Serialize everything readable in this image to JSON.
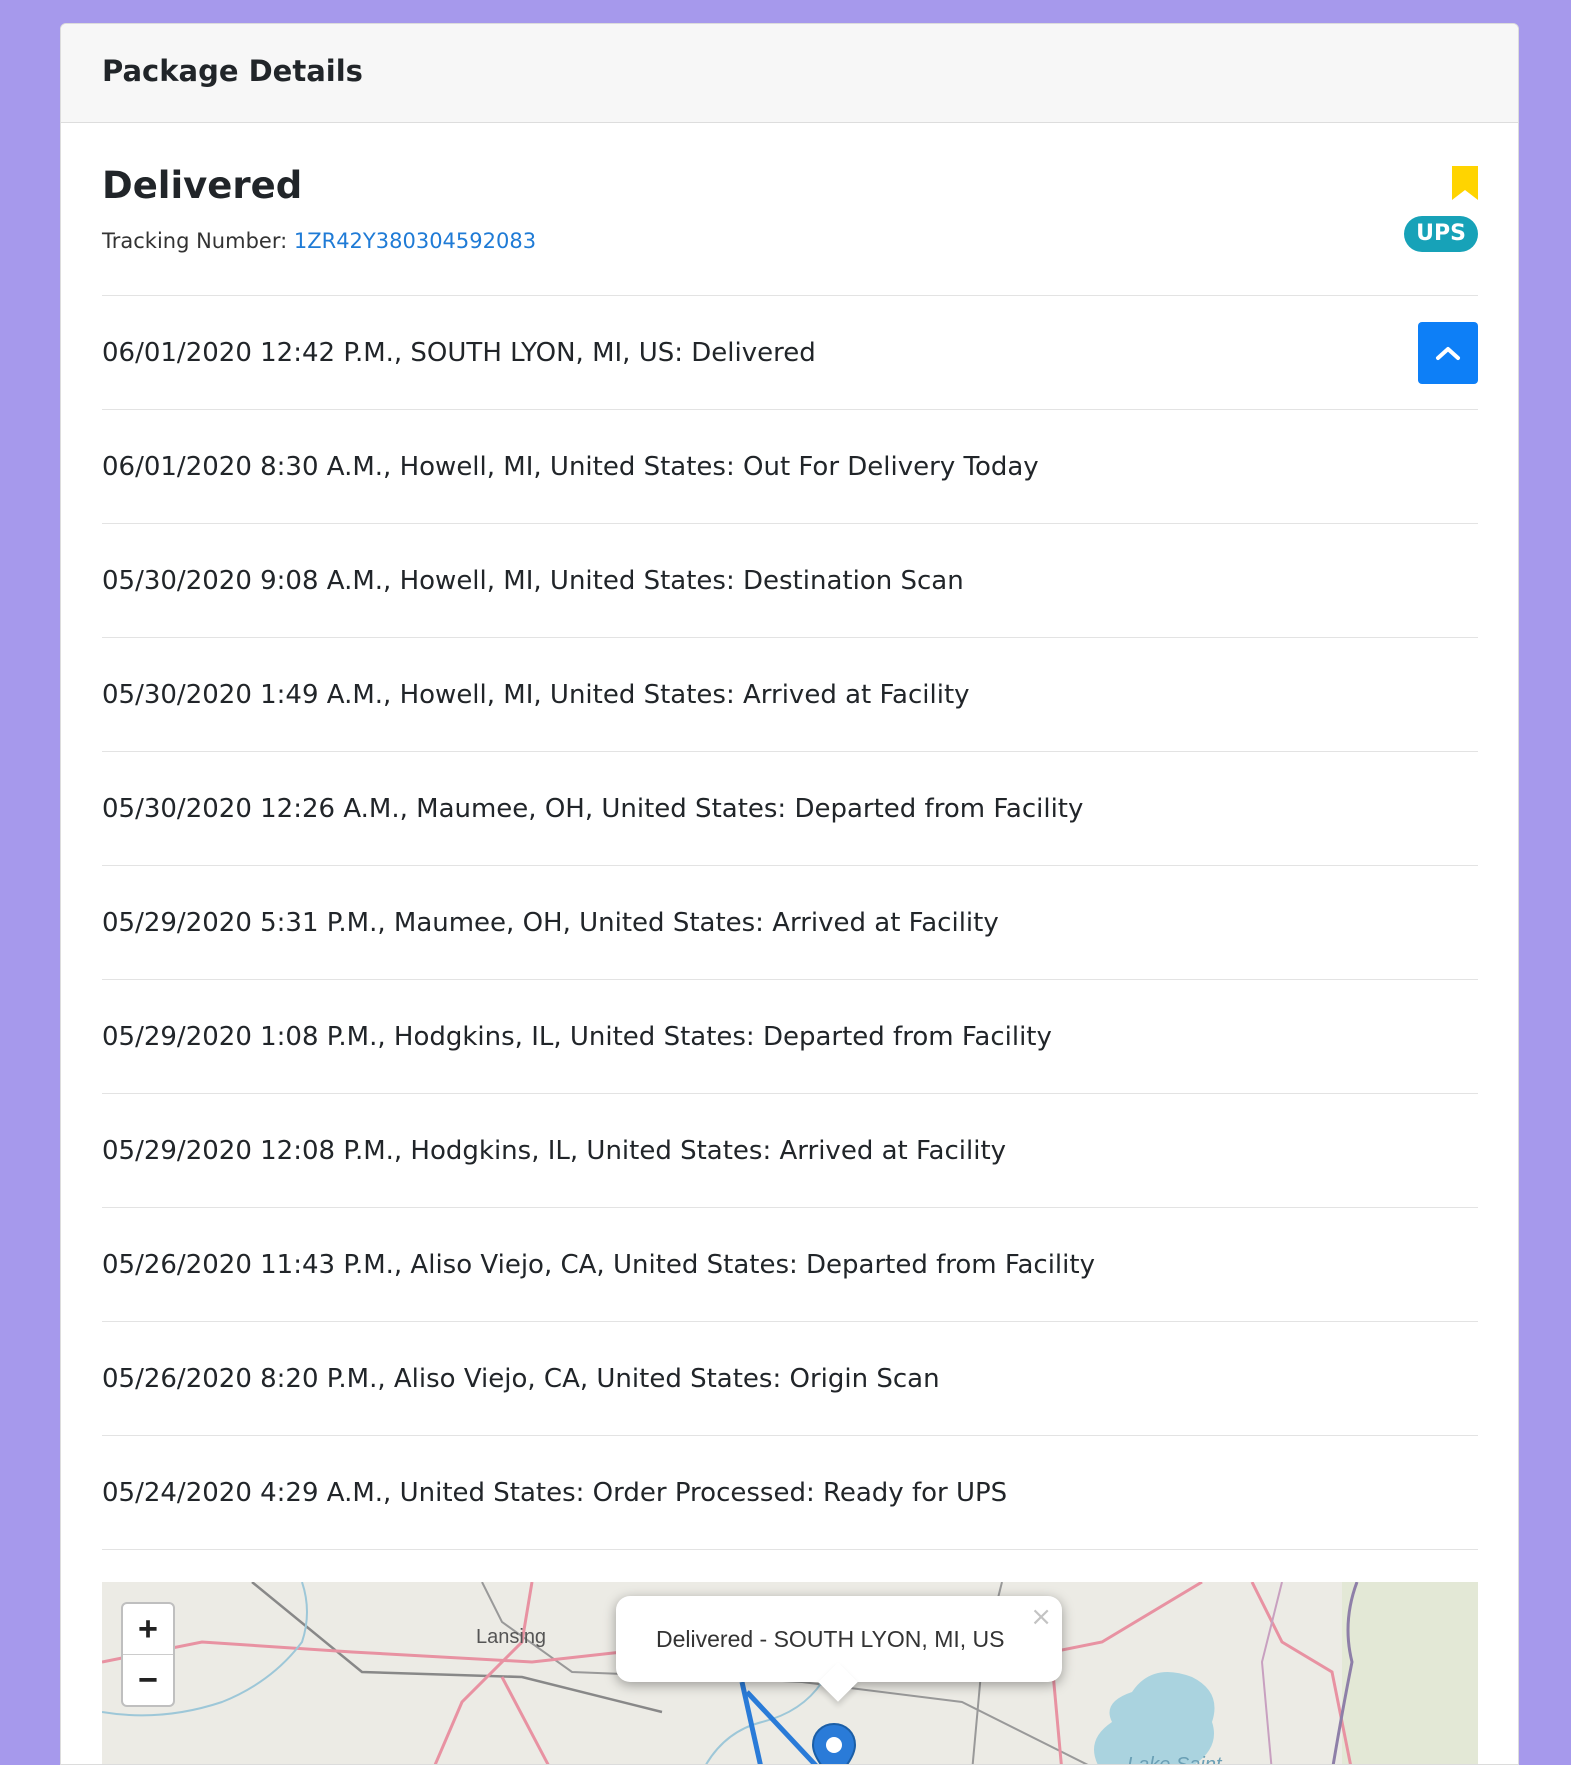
{
  "header": {
    "title": "Package Details"
  },
  "package": {
    "status": "Delivered",
    "tracking_label": "Tracking Number:",
    "tracking_number": "1ZR42Y380304592083",
    "carrier": "UPS"
  },
  "events": [
    "06/01/2020 12:42 P.M., SOUTH LYON, MI, US: Delivered",
    "06/01/2020 8:30 A.M., Howell, MI, United States: Out For Delivery Today",
    "05/30/2020 9:08 A.M., Howell, MI, United States: Destination Scan",
    "05/30/2020 1:49 A.M., Howell, MI, United States: Arrived at Facility",
    "05/30/2020 12:26 A.M., Maumee, OH, United States: Departed from Facility",
    "05/29/2020 5:31 P.M., Maumee, OH, United States: Arrived at Facility",
    "05/29/2020 1:08 P.M., Hodgkins, IL, United States: Departed from Facility",
    "05/29/2020 12:08 P.M., Hodgkins, IL, United States: Arrived at Facility",
    "05/26/2020 11:43 P.M., Aliso Viejo, CA, United States: Departed from Facility",
    "05/26/2020 8:20 P.M., Aliso Viejo, CA, United States: Origin Scan",
    "05/24/2020 4:29 A.M., United States: Order Processed: Ready for UPS"
  ],
  "map": {
    "zoom_in": "+",
    "zoom_out": "−",
    "popup_text": "Delivered - SOUTH LYON, MI, US",
    "popup_close": "×",
    "place_labels": [
      "Lansing",
      "Lake Saint"
    ]
  },
  "colors": {
    "page_background": "#a699ec",
    "link": "#1f7bd6",
    "badge": "#17a2b8",
    "bookmark": "#ffd400",
    "primary_button": "#0d7ff7",
    "route": "#2a7bd8"
  },
  "icons": {
    "bookmark": "bookmark-icon",
    "collapse": "chevron-up-icon",
    "marker": "map-marker-icon"
  }
}
